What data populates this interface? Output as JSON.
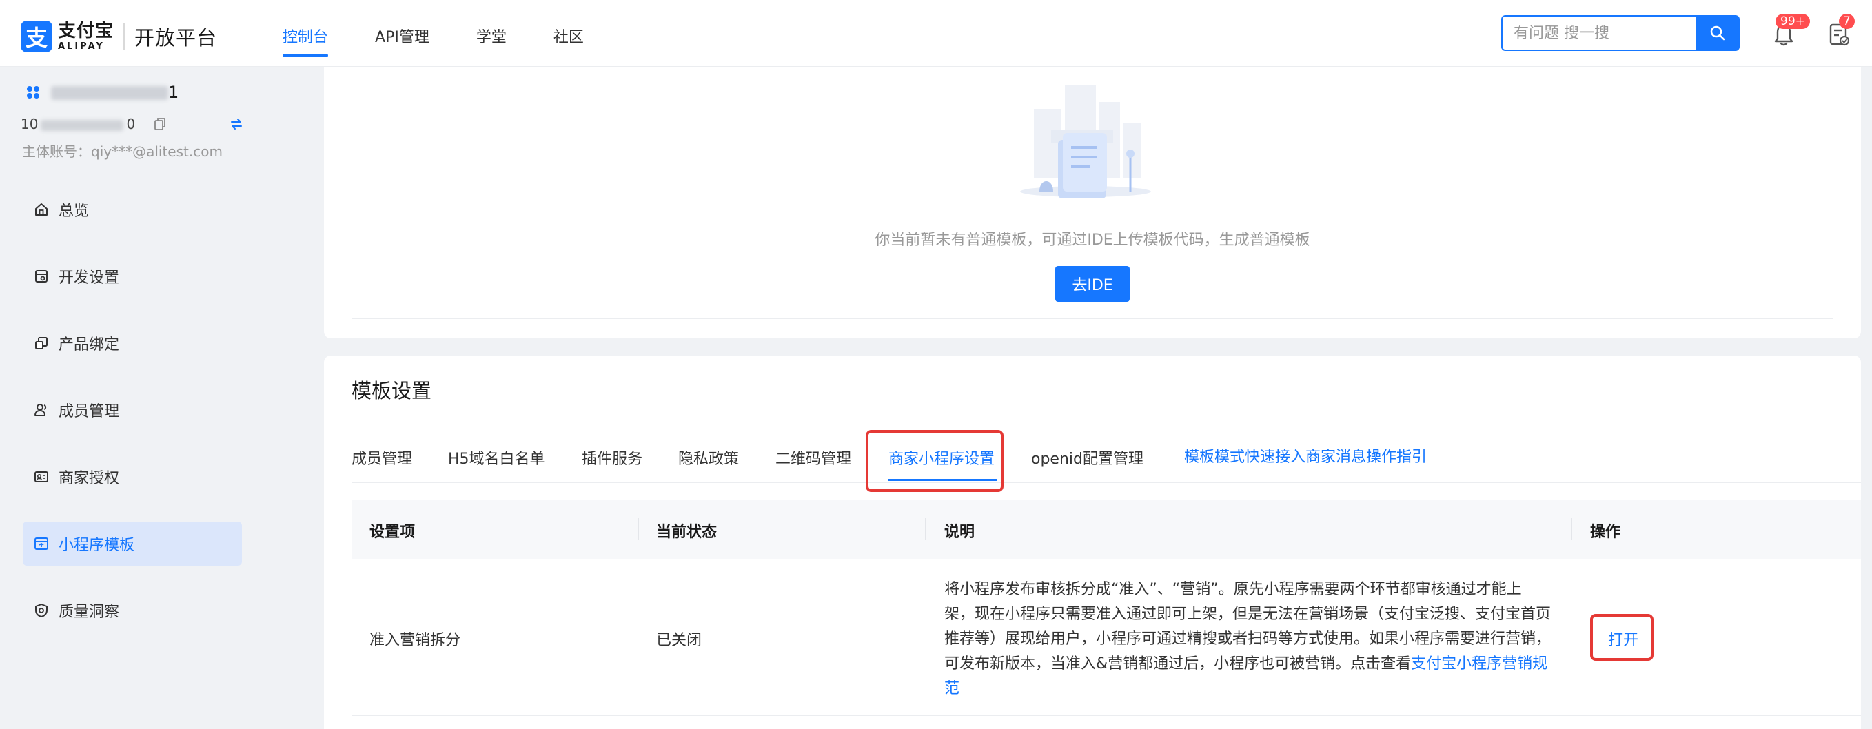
{
  "header": {
    "logo_cn": "支付宝",
    "logo_en": "ALIPAY",
    "platform": "开放平台",
    "nav": [
      {
        "label": "控制台",
        "active": true
      },
      {
        "label": "API管理",
        "active": false
      },
      {
        "label": "学堂",
        "active": false
      },
      {
        "label": "社区",
        "active": false
      }
    ],
    "search_placeholder": "有问题 搜一搜",
    "notification_badge": "99+",
    "todo_badge": "7"
  },
  "sidebar": {
    "account_suffix": "1",
    "account_id_prefix": "10",
    "account_id_suffix": "0",
    "main_account": "主体账号：qiy***@alitest.com",
    "items": [
      {
        "label": "总览",
        "icon": "home-icon"
      },
      {
        "label": "开发设置",
        "icon": "dev-settings-icon"
      },
      {
        "label": "产品绑定",
        "icon": "product-bind-icon"
      },
      {
        "label": "成员管理",
        "icon": "members-icon"
      },
      {
        "label": "商家授权",
        "icon": "merchant-auth-icon"
      },
      {
        "label": "小程序模板",
        "icon": "miniapp-template-icon",
        "active": true
      },
      {
        "label": "质量洞察",
        "icon": "quality-icon"
      }
    ]
  },
  "empty_state": {
    "text": "你当前暂未有普通模板，可通过IDE上传模板代码，生成普通模板",
    "button": "去IDE"
  },
  "template_settings": {
    "title": "模板设置",
    "tabs": [
      {
        "label": "成员管理"
      },
      {
        "label": "H5域名白名单"
      },
      {
        "label": "插件服务"
      },
      {
        "label": "隐私政策"
      },
      {
        "label": "二维码管理"
      },
      {
        "label": "商家小程序设置",
        "active": true
      },
      {
        "label": "openid配置管理"
      }
    ],
    "guide_link": "模板模式快速接入商家消息操作指引",
    "table": {
      "headers": [
        "设置项",
        "当前状态",
        "说明",
        "操作"
      ],
      "rows": [
        {
          "item": "准入营销拆分",
          "status": "已关闭",
          "description": "将小程序发布审核拆分成“准入”、“营销”。原先小程序需要两个环节都审核通过才能上架，现在小程序只需要准入通过即可上架，但是无法在营销场景（支付宝泛搜、支付宝首页推荐等）展现给用户，小程序可通过精搜或者扫码等方式使用。如果小程序需要进行营销，可发布新版本，当准入&营销都通过后，小程序也可被营销。点击查看",
          "description_link": "支付宝小程序营销规范",
          "action": "打开"
        }
      ]
    }
  },
  "colors": {
    "accent": "#1677ff",
    "highlight": "#e53935",
    "badge": "#ff4d4f"
  }
}
